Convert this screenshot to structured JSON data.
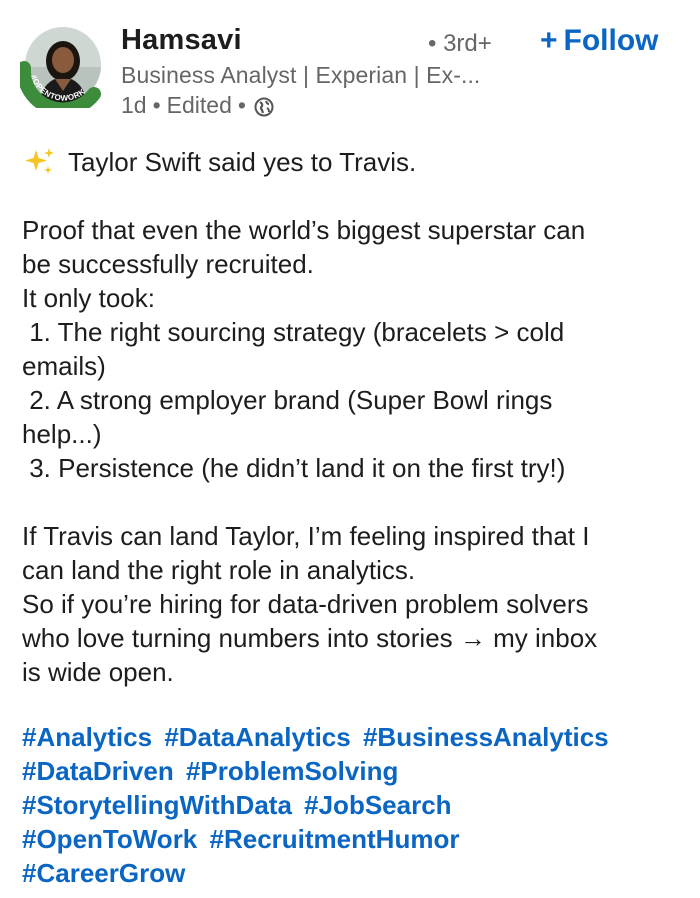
{
  "author": {
    "name": "Hamsavi",
    "degree": "• 3rd+",
    "headline": "Business Analyst | Experian | Ex-...",
    "avatar_badge": "#OPENTOWORK"
  },
  "meta": {
    "time": "1d",
    "sep1": "•",
    "edited": "Edited",
    "sep2": "•",
    "visibility_icon": "globe-icon"
  },
  "follow": {
    "plus": "+",
    "label": "Follow"
  },
  "post": {
    "line1": "Taylor Swift said yes to Travis.",
    "p2": [
      "Proof that even the world’s biggest superstar can",
      "be successfully recruited.",
      "It only took:",
      " 1. The right sourcing strategy (bracelets > cold",
      "emails)",
      " 2. A strong employer brand (Super Bowl rings",
      "help...)",
      " 3. Persistence (he didn’t land it on the first try!)"
    ],
    "p3": [
      "If Travis can land Taylor, I’m feeling inspired that I",
      "can land the right role in analytics.",
      "So if you’re hiring for data-driven problem solvers",
      "who love turning numbers into stories → my inbox",
      "is wide open."
    ]
  },
  "hashtags": [
    [
      "#Analytics",
      "#DataAnalytics",
      "#BusinessAnalytics"
    ],
    [
      "#DataDriven",
      "#ProblemSolving"
    ],
    [
      "#StorytellingWithData",
      "#JobSearch"
    ],
    [
      "#OpenToWork",
      "#RecruitmentHumor"
    ],
    [
      "#CareerGrow"
    ]
  ],
  "colors": {
    "link": "#0a66c2",
    "text": "#1d1d1d",
    "muted": "#666666",
    "open_to_work_ring": "#3c8c3c"
  }
}
